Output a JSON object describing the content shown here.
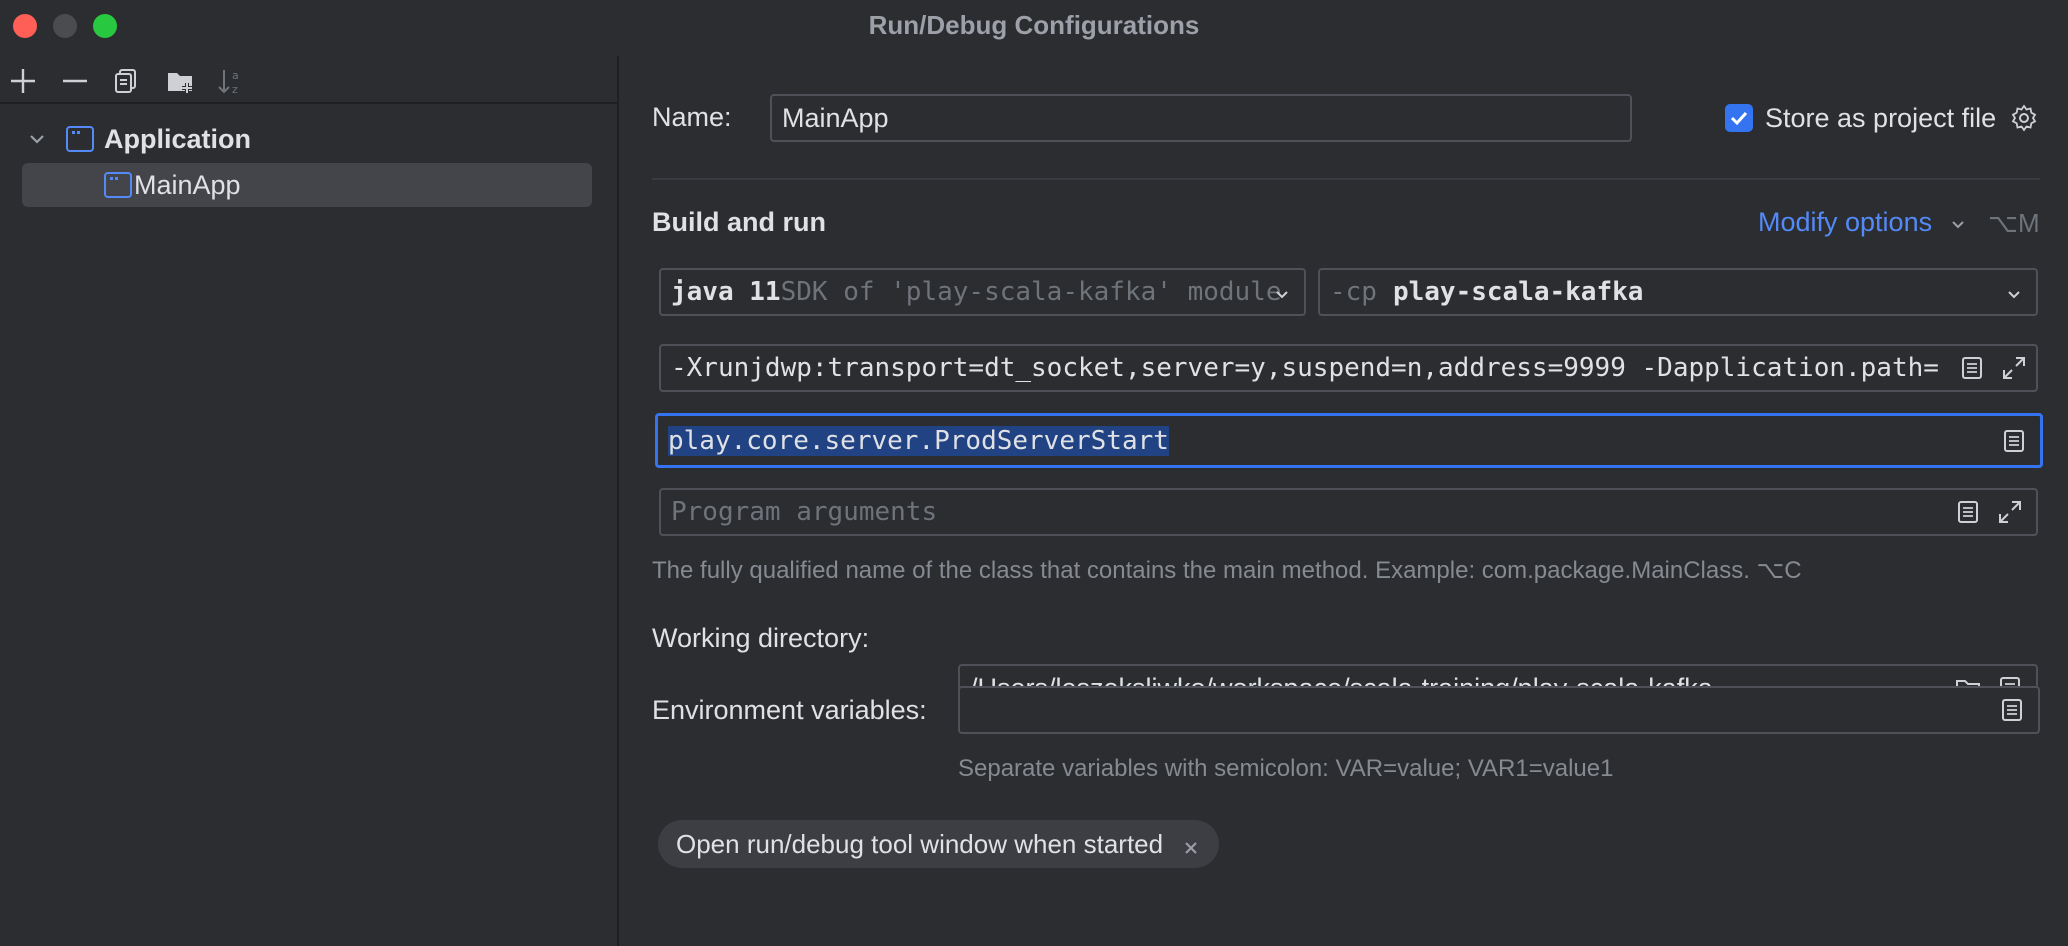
{
  "window": {
    "title": "Run/Debug Configurations"
  },
  "toolbar": {
    "icons": [
      "add-icon",
      "remove-icon",
      "copy-icon",
      "new-folder-icon",
      "sort-icon"
    ]
  },
  "tree": {
    "group_label": "Application",
    "item_label": "MainApp"
  },
  "form": {
    "name_label": "Name:",
    "name_value": "MainApp",
    "store_label": "Store as project file",
    "store_checked": true,
    "section_title": "Build and run",
    "modify_options": "Modify options",
    "modify_shortcut": "⌥M",
    "jdk_primary": "java 11",
    "jdk_secondary": "SDK of 'play-scala-kafka' module",
    "cp_prefix": "-cp",
    "cp_value": "play-scala-kafka",
    "vm_options": "-Xrunjdwp:transport=dt_socket,server=y,suspend=n,address=9999 -Dapplication.path=",
    "main_class": "play.core.server.ProdServerStart",
    "program_args_placeholder": "Program arguments",
    "main_class_hint": "The fully qualified name of the class that contains the main method. Example: com.package.MainClass. ⌥C",
    "working_dir_label": "Working directory:",
    "working_dir_value": "/Users/leszeksliwko/workspace/scala-training/play-scala-kafka",
    "env_label": "Environment variables:",
    "env_value": "",
    "env_hint": "Separate variables with semicolon: VAR=value; VAR1=value1",
    "chip_label": "Open run/debug tool window when started"
  },
  "colors": {
    "background": "#2b2d30",
    "accent": "#3574f0",
    "link": "#548af7",
    "selection": "#214283"
  }
}
